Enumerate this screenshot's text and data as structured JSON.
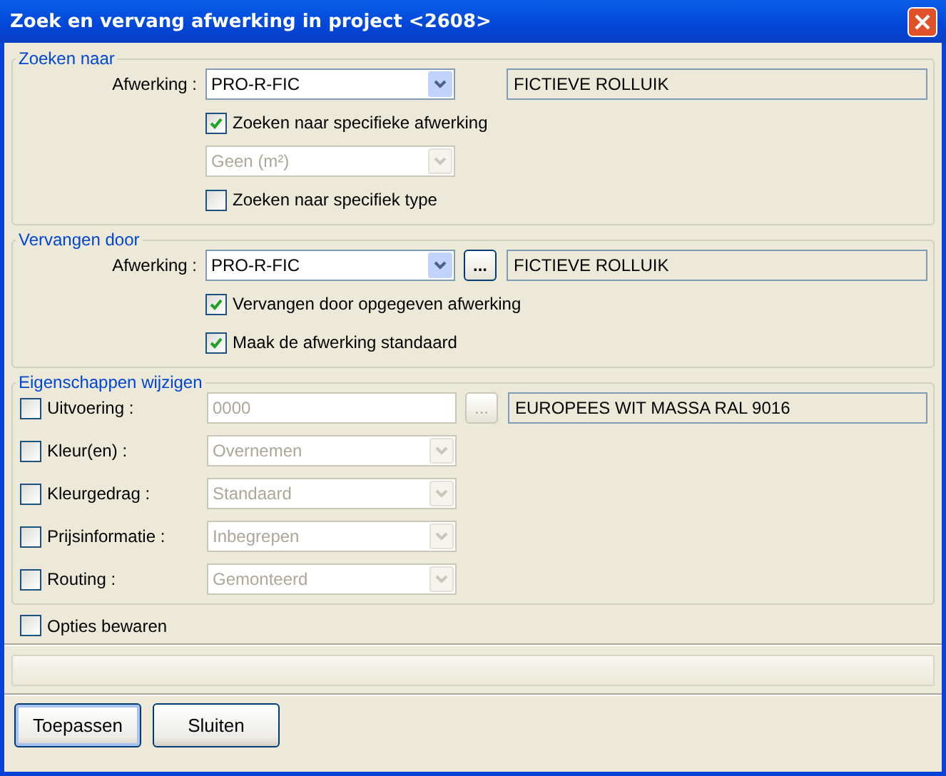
{
  "window": {
    "title": "Zoek en vervang afwerking in project <2608>"
  },
  "groups": [
    {
      "legend": "Zoeken naar",
      "rows": [
        {
          "kind": "field",
          "label": "Afwerking :",
          "control": {
            "kind": "combo",
            "value": "PRO-R-FIC",
            "disabled": false
          },
          "description": "FICTIEVE ROLLUIK"
        },
        {
          "kind": "check",
          "label": "Zoeken naar specifieke afwerking",
          "checked": true
        },
        {
          "kind": "control",
          "control": {
            "kind": "combo",
            "value": "Geen (m²)",
            "disabled": true
          }
        },
        {
          "kind": "check",
          "label": "Zoeken naar specifiek type",
          "checked": false
        }
      ]
    },
    {
      "legend": "Vervangen door",
      "rows": [
        {
          "kind": "field",
          "label": "Afwerking :",
          "control": {
            "kind": "combo",
            "value": "PRO-R-FIC",
            "disabled": false
          },
          "browse": {
            "label": "...",
            "disabled": false
          },
          "description": "FICTIEVE ROLLUIK"
        },
        {
          "kind": "check",
          "label": "Vervangen door opgegeven afwerking",
          "checked": true
        },
        {
          "kind": "check",
          "label": "Maak de afwerking standaard",
          "checked": true
        }
      ]
    },
    {
      "legend": "Eigenschappen wijzigen",
      "rows": [
        {
          "kind": "check_field",
          "label": "Uitvoering :",
          "checked": false,
          "control": {
            "kind": "text",
            "value": "0000",
            "disabled": true
          },
          "browse": {
            "label": "...",
            "disabled": true
          },
          "description": "EUROPEES WIT MASSA RAL 9016"
        },
        {
          "kind": "check_field",
          "label": "Kleur(en) :",
          "checked": false,
          "control": {
            "kind": "combo",
            "value": "Overnemen",
            "disabled": true
          }
        },
        {
          "kind": "check_field",
          "label": "Kleurgedrag :",
          "checked": false,
          "control": {
            "kind": "combo",
            "value": "Standaard",
            "disabled": true
          }
        },
        {
          "kind": "check_field",
          "label": "Prijsinformatie :",
          "checked": false,
          "control": {
            "kind": "combo",
            "value": "Inbegrepen",
            "disabled": true
          }
        },
        {
          "kind": "check_field",
          "label": "Routing :",
          "checked": false,
          "control": {
            "kind": "combo",
            "value": "Gemonteerd",
            "disabled": true
          }
        }
      ]
    }
  ],
  "save_options": {
    "label": "Opties bewaren",
    "checked": false
  },
  "progress": {
    "level": 0
  },
  "buttons": [
    {
      "label": "Toepassen",
      "default": true
    },
    {
      "label": "Sluiten",
      "default": false
    }
  ]
}
